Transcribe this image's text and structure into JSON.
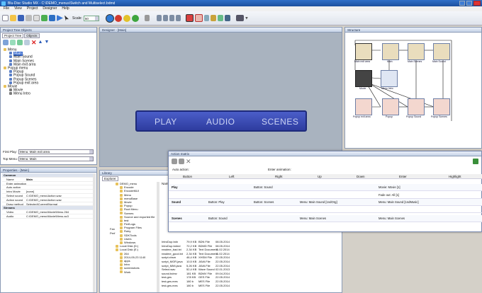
{
  "window": {
    "title": "Blu-Disc Studio MX - C:\\DEMO_menus\\Switch and Multiselect.bdmd"
  },
  "menubar": [
    "File",
    "View",
    "Project",
    "Designer",
    "Help"
  ],
  "toolbar": {
    "scale_label": "Scale:",
    "scale_value": "50"
  },
  "project_tree": {
    "title": "Project Tree Objects",
    "tabs": [
      "Project Tree",
      "Objects"
    ],
    "items": [
      {
        "label": "Menu",
        "level": 0
      },
      {
        "label": "Main",
        "level": 1
      },
      {
        "label": "Main Sound",
        "level": 1
      },
      {
        "label": "Main Scenes",
        "level": 1
      },
      {
        "label": "Main exit area",
        "level": 1
      },
      {
        "label": "Popup menu",
        "level": 0
      },
      {
        "label": "Popup",
        "level": 1
      },
      {
        "label": "Popup Sound",
        "level": 1
      },
      {
        "label": "Popup Scenes",
        "level": 1
      },
      {
        "label": "Popup exit area",
        "level": 1
      },
      {
        "label": "Movie",
        "level": 0
      },
      {
        "label": "Movie",
        "level": 1
      },
      {
        "label": "Menu Intro",
        "level": 1
      }
    ],
    "first_play_label": "First Play:",
    "first_play_value": "Menu: Main exit area",
    "top_menu_label": "Top Menu:",
    "top_menu_value": "Menu: Main"
  },
  "properties": {
    "title": "Properties - [Main]",
    "rows": [
      {
        "name": "Common",
        "value": "",
        "section": true
      },
      {
        "name": "Name",
        "value": "Main",
        "bold": true
      },
      {
        "name": "Enter animation",
        "value": ""
      },
      {
        "name": "Auto action",
        "value": ""
      },
      {
        "name": "Intro Movie",
        "value": "[none]"
      },
      {
        "name": "Select sound",
        "value": "C:\\DEMO_menu\\Action.wav"
      },
      {
        "name": "Action sound",
        "value": "C:\\DEMO_menu\\Action.wav"
      },
      {
        "name": "Draw method",
        "value": "Selected\\Current\\Normal"
      },
      {
        "name": "Streams",
        "value": "",
        "section": true
      },
      {
        "name": "Video",
        "value": "C:\\DEMO_menu\\Movie\\Menu.264"
      },
      {
        "name": "Audio",
        "value": "C:\\DEMO_menu\\Movie\\Menu.ac3"
      }
    ]
  },
  "designer": {
    "title": "Designer - [Main]",
    "buttons": [
      "PLAY",
      "AUDIO",
      "SCENES"
    ]
  },
  "structure": {
    "title": "Structure",
    "nodes": [
      "Main exit area",
      "Main",
      "Main Scenes",
      "Main Sound",
      "Movie",
      "Menu Intro",
      "Popup exit area",
      "Popup",
      "Popup Sound",
      "Popup Scenes"
    ]
  },
  "library": {
    "title": "Library",
    "tab": "Explorer",
    "folders": [
      "DEMO_menu",
      "Encode",
      "EncodeMUI",
      "Menu",
      "menuBase",
      "Movie",
      "Popup",
      "Root Menu",
      "Scenes",
      "Source and exported file",
      "test",
      "PerfLogs",
      "Program Files",
      "Ruby",
      "SDKTools",
      "Users",
      "Windows",
      "Local Disk (D:)",
      "Local Disk (E:)",
      "264",
      "2014-05-23 1140",
      "apps",
      "Intro",
      "screenshots",
      "Work"
    ],
    "pre_folders": [
      "Fan",
      "Perf"
    ],
    "name_header": "Name",
    "files": [
      {
        "name": "IntroDup.bdn",
        "size": "79,9 KB",
        "type": "BDN File",
        "date": "08.05.2014"
      },
      {
        "name": "IntroDup.bdmd",
        "size": "72,2 KB",
        "type": "BDMD File",
        "date": "08.05.2014"
      },
      {
        "name": "readme_bad.txt",
        "size": "2,34 KB",
        "type": "Text Document",
        "date": "11.02.2014"
      },
      {
        "name": "readme_good.txt",
        "size": "2,34 KB",
        "type": "Text Document",
        "date": "11.02.2014"
      },
      {
        "name": "script.xhsm",
        "size": "46,4 KB",
        "type": "XHSM File",
        "date": "22.05.2014"
      },
      {
        "name": "script_MGR.java",
        "size": "10,5 KB",
        "type": "JAVA File",
        "date": "22.05.2014"
      },
      {
        "name": "script_MMI.java",
        "size": "5,26 KB",
        "type": "JAVA File",
        "date": "22.05.2014"
      },
      {
        "name": "Select.wav",
        "size": "52,4 KB",
        "type": "Wave Sound",
        "date": "02.01.2013"
      },
      {
        "name": "sound.bdmv",
        "size": "181 KB",
        "type": "BDMV File",
        "date": "09.04.2014"
      },
      {
        "name": "test.ges",
        "size": "178 KB",
        "type": "GES File",
        "date": "22.05.2014"
      },
      {
        "name": "test.ges.mes",
        "size": "180 b",
        "type": "MES File",
        "date": "22.05.2014"
      },
      {
        "name": "test.ges.mes",
        "size": "180 b",
        "type": "MES File",
        "date": "22.05.2014"
      }
    ]
  },
  "action_matrix": {
    "title": "Action matrix",
    "auto_action_label": "Auto action:",
    "enter_animation_label": "Enter animation:",
    "columns": [
      "Button",
      "Left",
      "Right",
      "Up",
      "Down",
      "Enter",
      "Highlight"
    ],
    "rows": [
      {
        "button": "Play",
        "left": "",
        "right": "Button: Sound",
        "up": "",
        "down": "",
        "enter": "Movie: Movie [1]",
        "highlight": ""
      },
      {
        "button": "",
        "left": "",
        "right": "",
        "up": "",
        "down": "",
        "enter": "Fade out: All [1]",
        "highlight": ""
      },
      {
        "button": "Sound",
        "left": "Button: Play",
        "right": "Button: Scenes",
        "up": "Menu: Main Sound [1ndOrg]",
        "down": "",
        "enter": "Menu: Main Sound [1ndMusic]",
        "highlight": ""
      },
      {
        "button": "",
        "left": "",
        "right": "",
        "up": "",
        "down": "",
        "enter": "",
        "highlight": ""
      },
      {
        "button": "Scenes",
        "left": "Button: Sound",
        "right": "",
        "up": "Menu: Main Scenes",
        "down": "",
        "enter": "Menu: Main Scenes",
        "highlight": ""
      }
    ]
  }
}
